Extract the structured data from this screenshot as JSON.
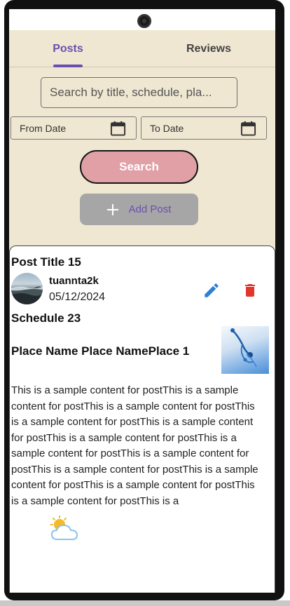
{
  "tabs": [
    {
      "label": "Posts",
      "active": true
    },
    {
      "label": "Reviews",
      "active": false
    }
  ],
  "search": {
    "placeholder": "Search by title, schedule, pla...",
    "value": ""
  },
  "filters": {
    "from_label": "From Date",
    "to_label": "To Date"
  },
  "actions": {
    "search_label": "Search",
    "add_post_label": "Add Post"
  },
  "post": {
    "title": "Post Title 15",
    "author": "tuannta2k",
    "date": "05/12/2024",
    "schedule": "Schedule 23",
    "place": "Place Name Place NamePlace 1",
    "content": "This is a sample content for postThis is a sample content for postThis is a sample content for postThis is a sample content for postThis is a sample content for postThis is a sample content for postThis is a sample content for postThis is a sample content for postThis is a sample content for postThis is a sample content for postThis is a sample content for postThis is a sample content for postThis is a"
  },
  "colors": {
    "app_background": "#efe7d1",
    "accent": "#6a4fb0",
    "search_button": "#e0a0a6",
    "add_button": "#a6a6a6",
    "edit_icon": "#2f7fd6",
    "delete_icon": "#e0362c"
  },
  "icons": {
    "from_date": "calendar-icon",
    "to_date": "calendar-icon",
    "add": "plus-icon",
    "edit": "pencil-icon",
    "delete": "trash-icon",
    "floating": "weather-icon"
  }
}
